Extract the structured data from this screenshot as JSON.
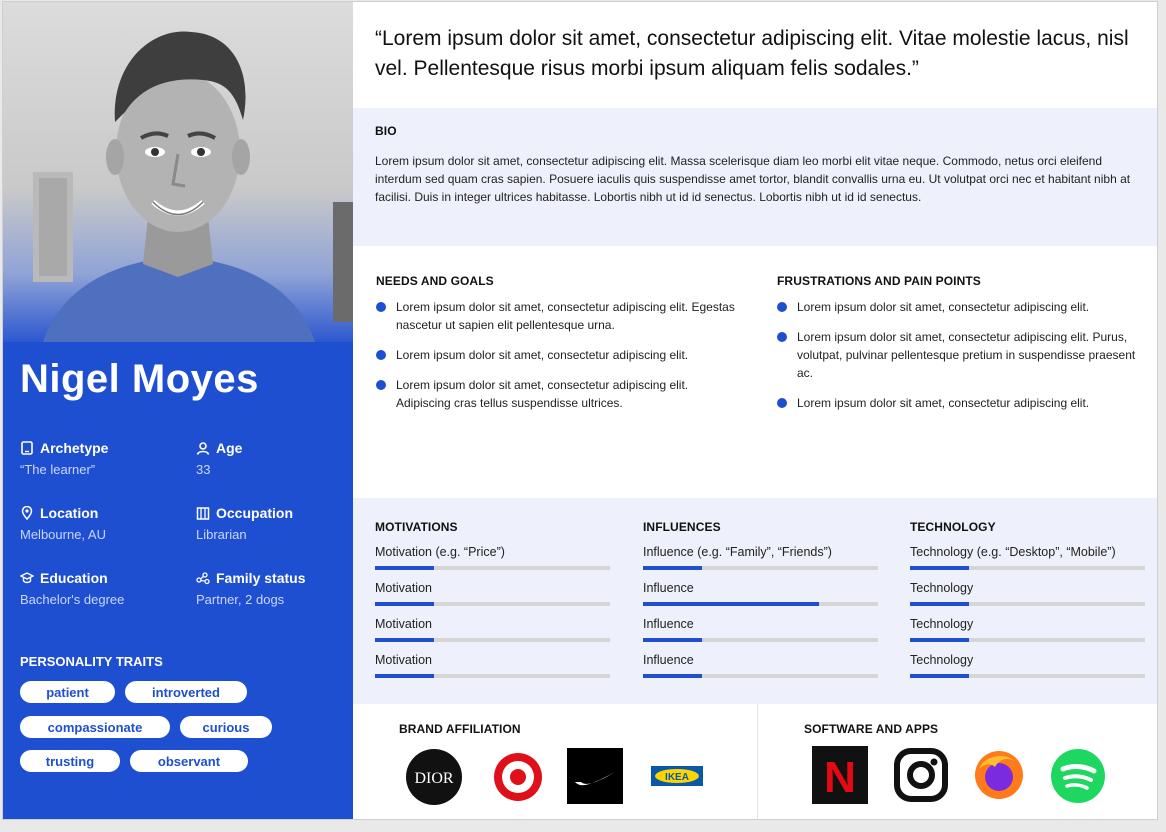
{
  "quote": "“Lorem ipsum dolor sit amet, consectetur adipiscing elit. Vitae molestie lacus, nisl vel. Pellentesque risus morbi ipsum aliquam felis sodales.”",
  "profile": {
    "name": "Nigel Moyes",
    "attributes": [
      {
        "label": "Archetype",
        "value": "“The learner”",
        "icon": "tablet-icon"
      },
      {
        "label": "Age",
        "value": "33",
        "icon": "user-icon"
      },
      {
        "label": "Location",
        "value": "Melbourne, AU",
        "icon": "location-pin-icon"
      },
      {
        "label": "Occupation",
        "value": "Librarian",
        "icon": "building-icon"
      },
      {
        "label": "Education",
        "value": "Bachelor's degree",
        "icon": "graduation-cap-icon"
      },
      {
        "label": "Family status",
        "value": "Partner, 2 dogs",
        "icon": "family-icon"
      }
    ],
    "traits_title": "PERSONALITY TRAITS",
    "traits": [
      "patient",
      "introverted",
      "compassionate",
      "curious",
      "trusting",
      "observant"
    ]
  },
  "bio": {
    "title": "BIO",
    "text": "Lorem ipsum dolor sit amet, consectetur adipiscing elit. Massa scelerisque diam leo morbi elit vitae neque. Commodo, netus orci eleifend interdum sed quam cras sapien. Posuere iaculis quis suspendisse amet tortor, blandit convallis urna eu. Ut volutpat orci nec et habitant nibh at facilisi. Duis in integer ultrices habitasse. Lobortis nibh ut id id senectus. Lobortis nibh ut id id senectus."
  },
  "needs": {
    "title": "NEEDS AND GOALS",
    "items": [
      "Lorem ipsum dolor sit amet, consectetur adipiscing elit. Egestas nascetur ut sapien elit pellentesque urna.",
      "Lorem ipsum dolor sit amet, consectetur adipiscing elit.",
      "Lorem ipsum dolor sit amet, consectetur adipiscing elit. Adipiscing cras tellus suspendisse ultrices."
    ]
  },
  "frustrations": {
    "title": "FRUSTRATIONS AND PAIN POINTS",
    "items": [
      "Lorem ipsum dolor sit amet, consectetur adipiscing elit.",
      "Lorem ipsum dolor sit amet, consectetur adipiscing elit. Purus, volutpat, pulvinar pellentesque pretium in suspendisse praesent ac.",
      "Lorem ipsum dolor sit amet, consectetur adipiscing elit."
    ]
  },
  "metrics": [
    {
      "title": "MOTIVATIONS",
      "rows": [
        {
          "label": "Motivation (e.g. “Price”)",
          "level": 0.25
        },
        {
          "label": "Motivation",
          "level": 0.25
        },
        {
          "label": "Motivation",
          "level": 0.25
        },
        {
          "label": "Motivation",
          "level": 0.25
        }
      ]
    },
    {
      "title": "INFLUENCES",
      "rows": [
        {
          "label": "Influence (e.g. “Family”, “Friends”)",
          "level": 0.25
        },
        {
          "label": "Influence",
          "level": 0.75
        },
        {
          "label": "Influence",
          "level": 0.25
        },
        {
          "label": "Influence",
          "level": 0.25
        }
      ]
    },
    {
      "title": "TECHNOLOGY",
      "rows": [
        {
          "label": "Technology (e.g. “Desktop”, “Mobile”)",
          "level": 0.25
        },
        {
          "label": "Technology",
          "level": 0.25
        },
        {
          "label": "Technology",
          "level": 0.25
        },
        {
          "label": "Technology",
          "level": 0.25
        }
      ]
    }
  ],
  "brands": {
    "title": "BRAND AFFILIATION",
    "logos": [
      {
        "icon": "dior-logo",
        "text": "DIOR"
      },
      {
        "icon": "target-logo"
      },
      {
        "icon": "nike-logo"
      },
      {
        "icon": "ikea-logo",
        "text": "IKEA"
      }
    ]
  },
  "apps": {
    "title": "SOFTWARE AND APPS",
    "logos": [
      {
        "icon": "netflix-logo",
        "text": "N"
      },
      {
        "icon": "instagram-logo"
      },
      {
        "icon": "firefox-logo"
      },
      {
        "icon": "spotify-logo"
      }
    ]
  },
  "colors": {
    "accent": "#1f4fd1",
    "light_panel": "#eef1fb",
    "bar_track": "#d6d6d6"
  }
}
